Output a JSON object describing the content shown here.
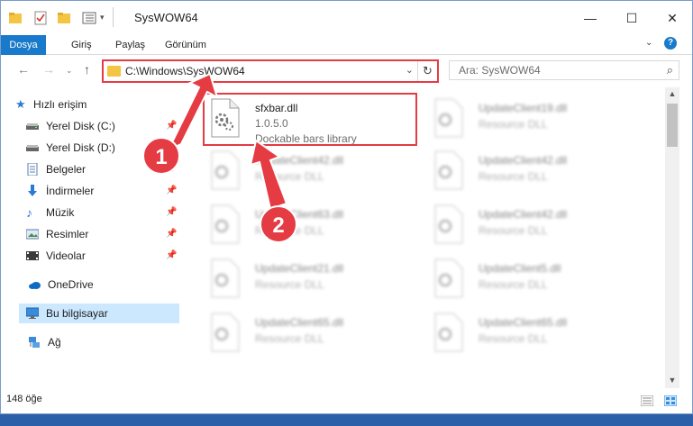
{
  "window": {
    "title": "SysWOW64",
    "minimize_glyph": "—",
    "maximize_glyph": "☐",
    "close_glyph": "✕"
  },
  "ribbon": {
    "tabs": [
      "Dosya",
      "Giriş",
      "Paylaş",
      "Görünüm"
    ],
    "file_tab_color": "#1979ca"
  },
  "address": {
    "path": "C:\\Windows\\SysWOW64",
    "search_placeholder": "Ara: SysWOW64",
    "highlight_color": "#e53b43"
  },
  "nav": {
    "items": [
      {
        "label": "Hızlı erişim",
        "icon": "star-icon",
        "pinned": false
      },
      {
        "label": "Yerel Disk (C:)",
        "icon": "drive-icon",
        "pinned": true
      },
      {
        "label": "Yerel Disk (D:)",
        "icon": "drive-icon",
        "pinned": true
      },
      {
        "label": "Belgeler",
        "icon": "document-icon",
        "pinned": true
      },
      {
        "label": "İndirmeler",
        "icon": "download-icon",
        "pinned": true
      },
      {
        "label": "Müzik",
        "icon": "music-icon",
        "pinned": true
      },
      {
        "label": "Resimler",
        "icon": "pictures-icon",
        "pinned": true
      },
      {
        "label": "Videolar",
        "icon": "video-icon",
        "pinned": true
      },
      {
        "label": "OneDrive",
        "icon": "cloud-icon",
        "pinned": false
      },
      {
        "label": "Bu bilgisayar",
        "icon": "computer-icon",
        "pinned": false
      },
      {
        "label": "Ağ",
        "icon": "network-icon",
        "pinned": false
      }
    ]
  },
  "files": [
    {
      "name": "sfxbar.dll",
      "line2": "1.0.5.0",
      "line3": "Dockable bars library",
      "highlighted": true
    },
    {
      "name": "UpdateClient19.dll",
      "line2": "Resource DLL",
      "line3": ""
    },
    {
      "name": "UpdateClient42.dll",
      "line2": "Resource DLL",
      "line3": ""
    },
    {
      "name": "UpdateClient42.dll",
      "line2": "Resource DLL",
      "line3": ""
    },
    {
      "name": "UpdateClient63.dll",
      "line2": "Resource DLL",
      "line3": ""
    },
    {
      "name": "UpdateClient42.dll",
      "line2": "Resource DLL",
      "line3": ""
    },
    {
      "name": "UpdateClient21.dll",
      "line2": "Resource DLL",
      "line3": ""
    },
    {
      "name": "UpdateClient5.dll",
      "line2": "Resource DLL",
      "line3": ""
    },
    {
      "name": "UpdateClient65.dll",
      "line2": "Resource DLL",
      "line3": ""
    },
    {
      "name": "UpdateClient65.dll",
      "line2": "Resource DLL",
      "line3": ""
    }
  ],
  "status": {
    "item_count": "148 öğe"
  },
  "annotations": {
    "badge1": "1",
    "badge2": "2"
  }
}
